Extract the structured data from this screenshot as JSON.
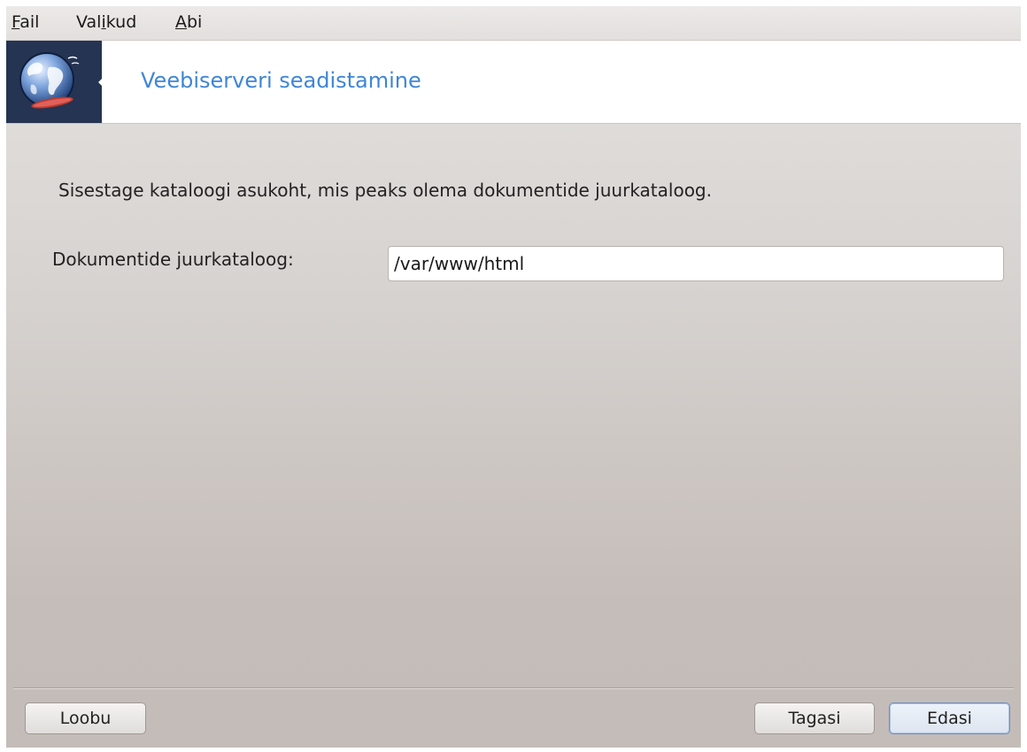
{
  "menu": {
    "file": {
      "mnemonic": "F",
      "rest": "ail"
    },
    "options": {
      "before": "Val",
      "mnemonic": "i",
      "after": "kud"
    },
    "help": {
      "mnemonic": "A",
      "rest": "bi"
    }
  },
  "header": {
    "title": "Veebiserveri seadistamine",
    "logo_icon": "web-globe-icon",
    "title_color": "#3f86d6"
  },
  "main": {
    "instruction": "Sisestage kataloogi asukoht, mis peaks olema dokumentide juurkataloog.",
    "document_root_label": "Dokumentide juurkataloog:",
    "document_root_value": "/var/www/html"
  },
  "buttons": {
    "cancel": "Loobu",
    "back": "Tagasi",
    "next": "Edasi"
  }
}
